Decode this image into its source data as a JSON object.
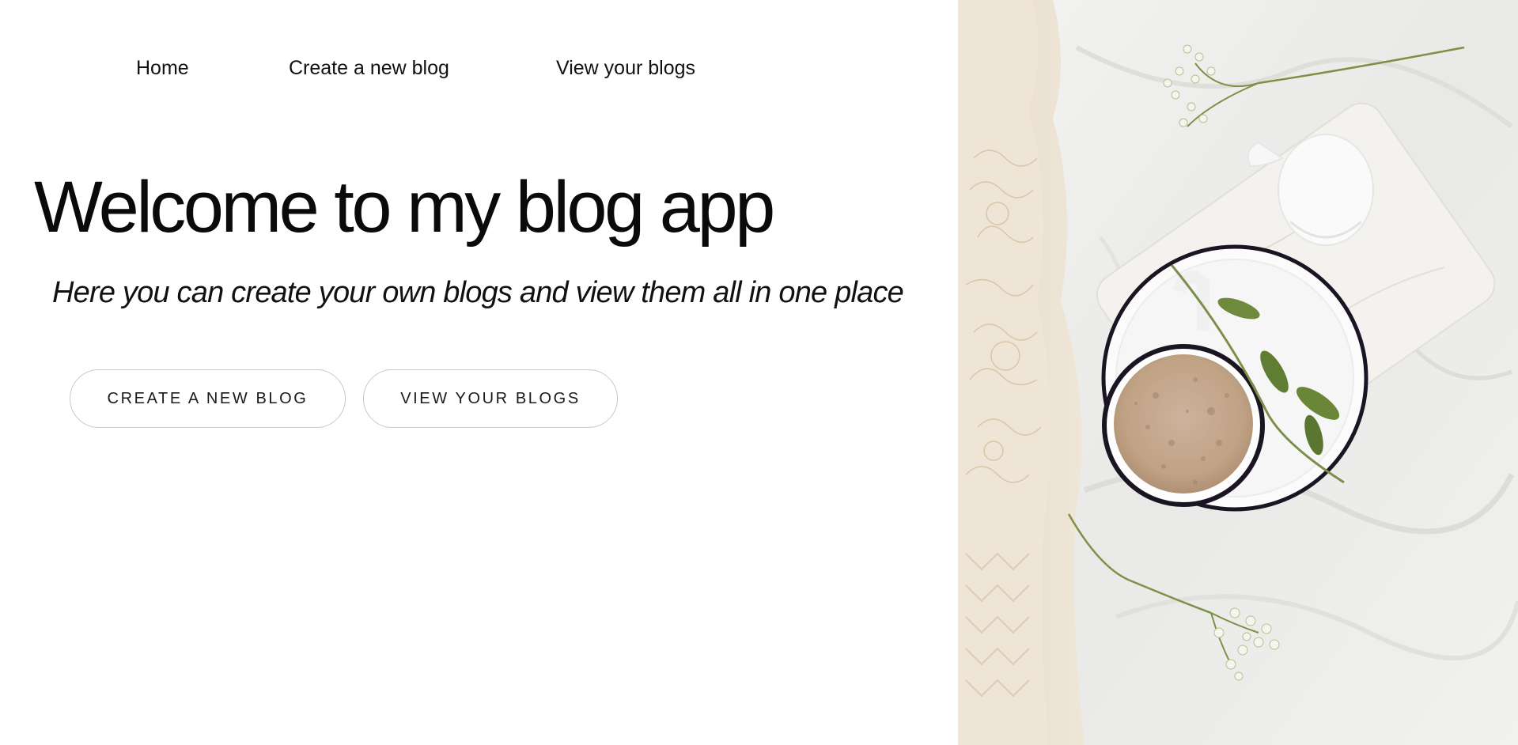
{
  "nav": {
    "items": [
      {
        "label": "Home"
      },
      {
        "label": "Create a new blog"
      },
      {
        "label": "View your blogs"
      }
    ]
  },
  "hero": {
    "title": "Welcome to my blog app",
    "subtitle": "Here you can create your own blogs and view them all in one place"
  },
  "actions": {
    "create_label": "CREATE A NEW BLOG",
    "view_label": "VIEW YOUR BLOGS"
  },
  "colors": {
    "background": "#ffffff",
    "text": "#111111",
    "button_border": "#c9c9c9"
  }
}
